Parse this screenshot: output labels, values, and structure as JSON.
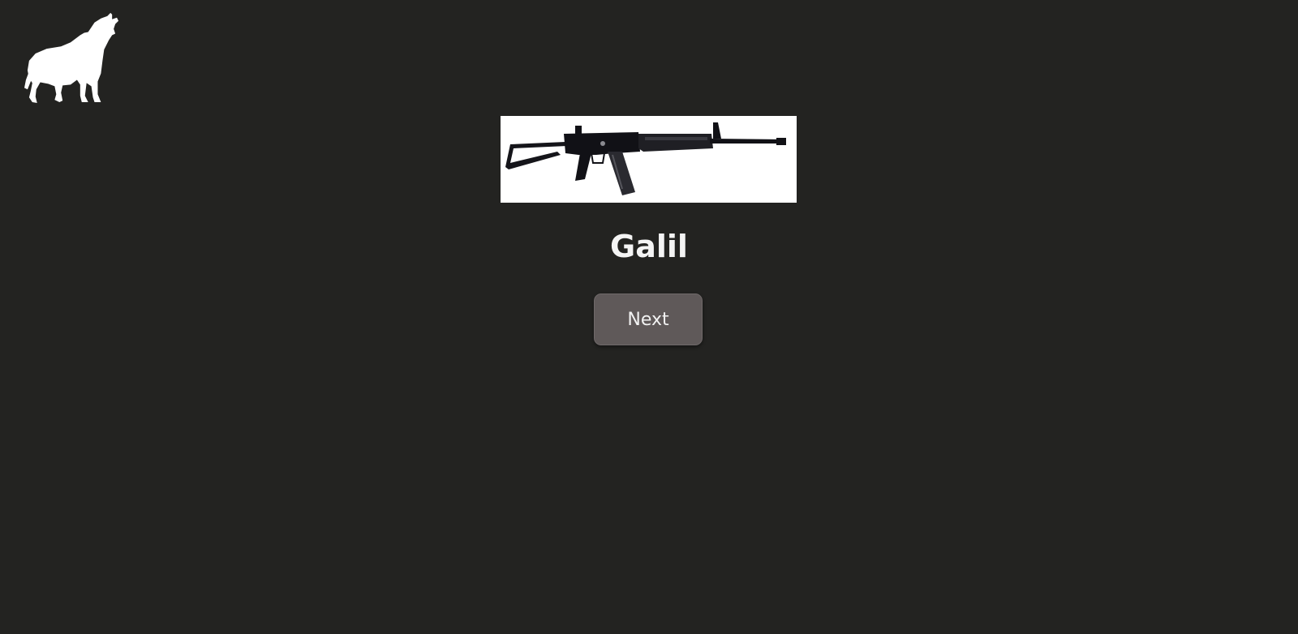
{
  "logo": {
    "icon": "howling-wolf-icon"
  },
  "weapon": {
    "name": "Galil",
    "image_icon": "assault-rifle-icon"
  },
  "controls": {
    "next_label": "Next"
  },
  "colors": {
    "background": "#232321",
    "button": "#5f5959",
    "text": "#f4f4f4"
  }
}
